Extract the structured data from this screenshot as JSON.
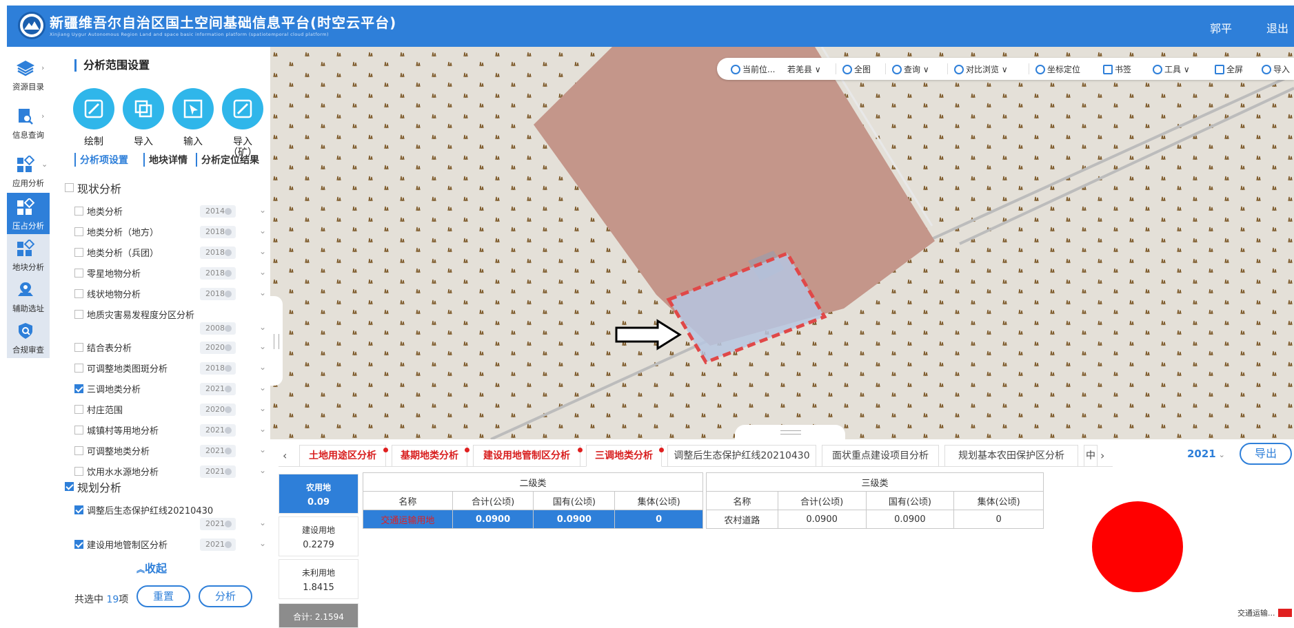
{
  "header": {
    "title": "新疆维吾尔自治区国土空间基础信息平台(时空云平台)",
    "subtitle": "Xinjiang Uygur Autonomous Region Land and space basic information platform (spatiotemporal cloud platform)",
    "user": "郭平",
    "logout": "退出",
    "color": "#2e7fd9"
  },
  "rail": {
    "items": [
      {
        "label": "资源目录",
        "icon": "layers-icon"
      },
      {
        "label": "信息查询",
        "icon": "search-doc-icon"
      },
      {
        "label": "应用分析",
        "icon": "apps-icon"
      },
      {
        "label": "压占分析",
        "icon": "apps-icon"
      },
      {
        "label": "地块分析",
        "icon": "apps-icon"
      },
      {
        "label": "辅助选址",
        "icon": "location-icon"
      },
      {
        "label": "合规审查",
        "icon": "shield-search-icon"
      }
    ]
  },
  "panel": {
    "range_title": "分析范围设置",
    "tools": [
      "绘制",
      "导入",
      "输入",
      "导入\n（矿）"
    ],
    "subtabs": [
      "分析项设置",
      "地块详情",
      "分析定位结果"
    ],
    "groups": [
      {
        "label": "现状分析",
        "checked": false
      },
      {
        "label": "规划分析",
        "checked": true
      }
    ],
    "items": [
      {
        "label": "地类分析",
        "year": "2014",
        "checked": false
      },
      {
        "label": "地类分析（地方）",
        "year": "2018",
        "checked": false
      },
      {
        "label": "地类分析（兵团）",
        "year": "2018",
        "checked": false
      },
      {
        "label": "零星地物分析",
        "year": "2018",
        "checked": false
      },
      {
        "label": "线状地物分析",
        "year": "2018",
        "checked": false
      },
      {
        "label": "地质灾害易发程度分区分析",
        "year": "2008",
        "checked": false
      },
      {
        "label": "结合表分析",
        "year": "2020",
        "checked": false
      },
      {
        "label": "可调整地类图斑分析",
        "year": "2018",
        "checked": false
      },
      {
        "label": "三调地类分析",
        "year": "2021",
        "checked": true
      },
      {
        "label": "村庄范围",
        "year": "2020",
        "checked": false
      },
      {
        "label": "城镇村等用地分析",
        "year": "2021",
        "checked": false
      },
      {
        "label": "可调整地类分析",
        "year": "2021",
        "checked": false
      },
      {
        "label": "饮用水水源地分析",
        "year": "2021",
        "checked": false
      },
      {
        "label": "调整后生态保护红线20210430",
        "year": "2021",
        "checked": true
      },
      {
        "label": "建设用地管制区分析",
        "year": "2021",
        "checked": true
      }
    ],
    "collapse": "收起",
    "selected_prefix": "共选中",
    "selected_count": "19",
    "selected_suffix": "项",
    "reset": "重置",
    "analyze": "分析"
  },
  "map_toolbar": {
    "items": [
      "当前位...",
      "若羌县",
      "全图",
      "查询",
      "对比浏览",
      "坐标定位",
      "书签",
      "工具",
      "全屏",
      "导入"
    ]
  },
  "bottom": {
    "tabs": [
      {
        "label": "土地用途区分析",
        "red": true,
        "dot": true
      },
      {
        "label": "基期地类分析",
        "red": true,
        "dot": true
      },
      {
        "label": "建设用地管制区分析",
        "red": true,
        "dot": true
      },
      {
        "label": "三调地类分析",
        "red": true,
        "dot": true,
        "active": true
      },
      {
        "label": "调整后生态保护红线20210430",
        "red": false
      },
      {
        "label": "面状重点建设项目分析",
        "red": false
      },
      {
        "label": "规划基本农田保护区分析",
        "red": false
      },
      {
        "label": "中",
        "red": false
      }
    ],
    "year": "2021",
    "export": "导出",
    "categories": [
      {
        "name": "农用地",
        "value": "0.09",
        "active": true
      },
      {
        "name": "建设用地",
        "value": "0.2279"
      },
      {
        "name": "未利用地",
        "value": "1.8415"
      }
    ],
    "total_label": "合计: 2.1594",
    "table_level2": {
      "group": "二级类",
      "headers": [
        "名称",
        "合计(公顷)",
        "国有(公顷)",
        "集体(公顷)"
      ],
      "rows": [
        [
          "交通运输用地",
          "0.0900",
          "0.0900",
          "0"
        ]
      ]
    },
    "table_level3": {
      "group": "三级类",
      "headers": [
        "名称",
        "合计(公顷)",
        "国有(公顷)",
        "集体(公顷)"
      ],
      "rows": [
        [
          "农村道路",
          "0.0900",
          "0.0900",
          "0"
        ]
      ]
    },
    "pie": {
      "color": "#ff0000",
      "value": 1.0
    },
    "legend": {
      "label": "交通运输...",
      "color": "#e02020"
    }
  }
}
